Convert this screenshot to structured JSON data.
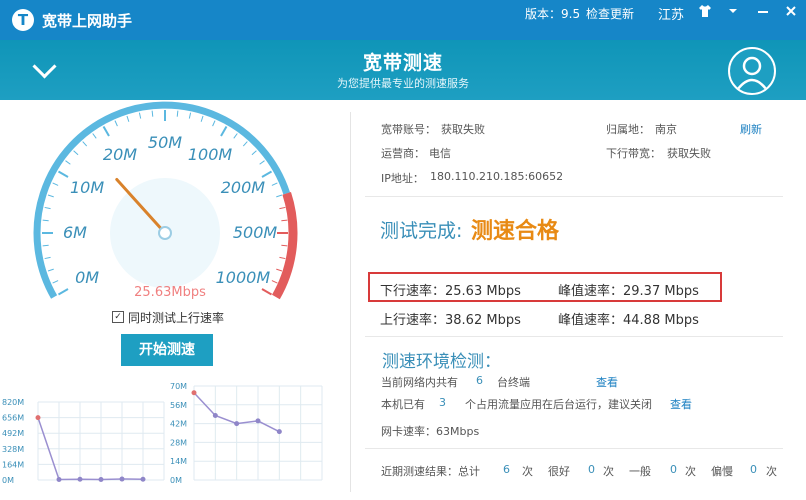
{
  "window": {
    "title": "宽带上网助手",
    "logo_glyph": "T",
    "version": "版本：9.5",
    "check_update": "检查更新",
    "city": "江苏"
  },
  "header": {
    "title": "宽带测速",
    "subtitle": "为您提供最专业的测速服务"
  },
  "gauge": {
    "ticks": [
      "0M",
      "6M",
      "10M",
      "20M",
      "50M",
      "100M",
      "200M",
      "500M",
      "1000M"
    ],
    "current_speed": "25.63Mbps",
    "needle_fraction": 0.325,
    "arc_color": "#5bb8e0",
    "red_color": "#e25c5c"
  },
  "controls": {
    "simul_check": "✓",
    "simul_label": "同时测试上行速率",
    "start_button": "开始测速"
  },
  "mini_charts": {
    "left": {
      "yticks": [
        "820M",
        "656M",
        "492M",
        "328M",
        "164M",
        "0M"
      ],
      "ymax": 820,
      "values": [
        656,
        5,
        8,
        5,
        10,
        8
      ]
    },
    "right": {
      "yticks": [
        "70M",
        "56M",
        "42M",
        "28M",
        "14M",
        "0M"
      ],
      "ymax": 70,
      "values": [
        65,
        48,
        42,
        44,
        36
      ]
    }
  },
  "account": {
    "account_label": "宽带账号：",
    "account_value": "获取失败",
    "location_label": "归属地：",
    "location_value": "南京",
    "refresh": "刷新",
    "isp_label": "运营商：",
    "isp_value": "电信",
    "downlink_label": "下行带宽：",
    "downlink_value": "获取失败",
    "ip_label": "IP地址：",
    "ip_value": "180.110.210.185:60652"
  },
  "result": {
    "complete": "测试完成:",
    "verdict": "测速合格",
    "down_rate": "下行速率：25.63 Mbps",
    "down_peak": "峰值速率：29.37 Mbps",
    "up_rate": "上行速率：38.62 Mbps",
    "up_peak": "峰值速率：44.88 Mbps"
  },
  "environment": {
    "title": "测速环境检测：",
    "lan_prefix": "当前网络内共有",
    "lan_count": "6",
    "lan_suffix": "台终端",
    "lan_view": "查看",
    "apps_prefix": "本机已有",
    "apps_count": "3",
    "apps_suffix": "个占用流量应用在后台运行，建议关闭",
    "apps_view": "查看",
    "nic_rate": "网卡速率：63Mbps"
  },
  "recent": {
    "label": "近期测速结果：总计",
    "total": "6",
    "unit": "次",
    "good_label": "很好",
    "good": "0",
    "avg_label": "一般",
    "avg": "0",
    "slow_label": "偏慢",
    "slow": "0"
  }
}
